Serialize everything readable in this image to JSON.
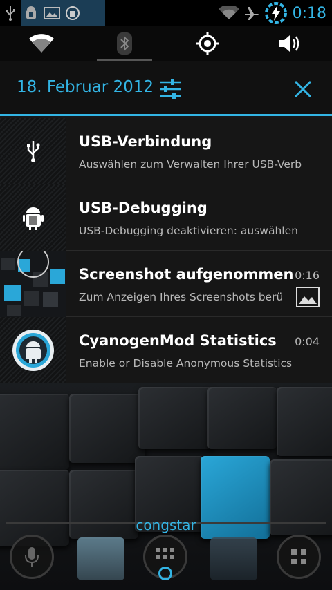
{
  "status_bar": {
    "left_icons": [
      "usb-icon",
      "android-debug-icon",
      "image-icon",
      "cyanogenmod-icon"
    ],
    "right_icons": [
      "wifi-icon",
      "airplane-icon",
      "battery-charging-icon"
    ],
    "time": "0:18"
  },
  "quick_toggles": [
    {
      "name": "wifi",
      "icon": "wifi-icon",
      "state": "on"
    },
    {
      "name": "bluetooth",
      "icon": "bluetooth-icon",
      "state": "off"
    },
    {
      "name": "gps",
      "icon": "gps-icon",
      "state": "on"
    },
    {
      "name": "sound",
      "icon": "speaker-icon",
      "state": "on"
    }
  ],
  "header": {
    "date": "18. Februar 2012",
    "settings_icon": "settings-sliders-icon",
    "close_icon": "close-icon"
  },
  "notifications": [
    {
      "icon": "usb-icon",
      "title": "USB-Verbindung",
      "text": "Auswählen zum Verwalten Ihrer USB-Verb",
      "time": ""
    },
    {
      "icon": "android-debug-icon",
      "title": "USB-Debugging",
      "text": "USB-Debugging deaktivieren: auswählen",
      "time": ""
    },
    {
      "icon": "screenshot-thumbnail",
      "title": "Screenshot aufgenommen",
      "text": "Zum Anzeigen Ihres Screenshots berü",
      "time": "0:16",
      "small_icon": "image-icon"
    },
    {
      "icon": "cyanogenmod-icon",
      "title": "CyanogenMod Statistics",
      "text": "Enable or Disable Anonymous Statistics",
      "time": "0:04"
    }
  ],
  "carrier": "congstar",
  "colors": {
    "accent": "#33b5e5",
    "panel": "#161616",
    "secondary_text": "#b8b8b8"
  }
}
